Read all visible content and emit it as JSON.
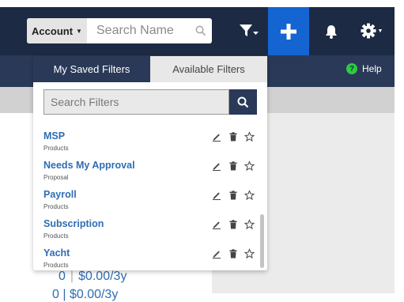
{
  "header": {
    "account_label": "Account",
    "search_placeholder": "Search Name"
  },
  "colors": {
    "header_bg": "#1d2a43",
    "accent_blue": "#1464d2",
    "link_blue": "#2f6db3",
    "help_green": "#2ecc40"
  },
  "icons": [
    "search-icon",
    "filter-icon",
    "plus-icon",
    "bell-icon",
    "gear-icon",
    "help-icon",
    "edit-icon",
    "trash-icon",
    "star-icon"
  ],
  "secondary_nav": {
    "help_label": "Help"
  },
  "dropdown": {
    "tabs": [
      {
        "label": "My Saved Filters",
        "active": true
      },
      {
        "label": "Available Filters",
        "active": false
      }
    ],
    "search_placeholder": "Search Filters",
    "items": [
      {
        "title": "MSP",
        "subtitle": "Products"
      },
      {
        "title": "Needs My Approval",
        "subtitle": "Proposal"
      },
      {
        "title": "Payroll",
        "subtitle": "Products"
      },
      {
        "title": "Subscription",
        "subtitle": "Products"
      },
      {
        "title": "Yacht",
        "subtitle": "Products"
      }
    ]
  },
  "background": {
    "count": "0",
    "amount": "$0.00/3y",
    "next_line": "0 | $0.00/3y"
  }
}
